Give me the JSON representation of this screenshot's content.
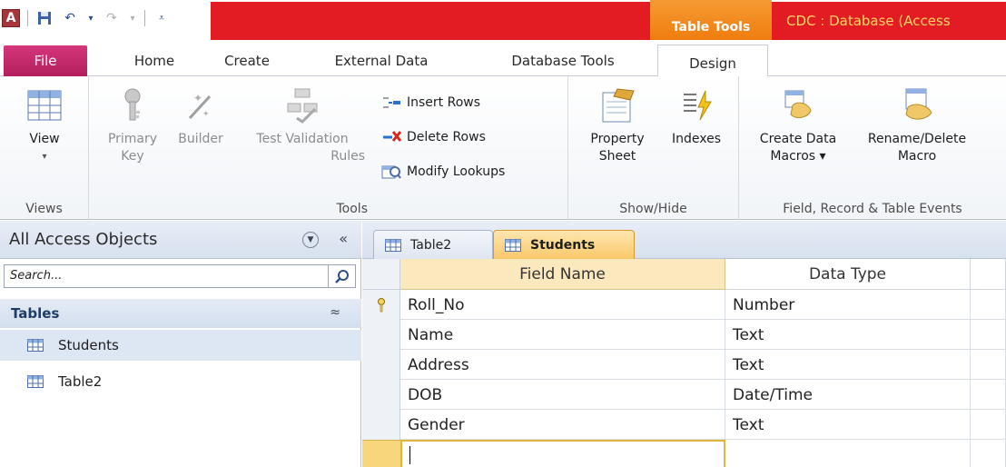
{
  "qat": {
    "app_letter": "A"
  },
  "title": {
    "context_tab": "Table Tools",
    "window_title": "CDC : Database (Access"
  },
  "tabs": {
    "file": "File",
    "home": "Home",
    "create": "Create",
    "external": "External Data",
    "dbtools": "Database Tools",
    "design": "Design"
  },
  "ribbon": {
    "views": {
      "label": "Views",
      "view_line1": "View",
      "view_line2": "▾"
    },
    "tools": {
      "label": "Tools",
      "primary_key_1": "Primary",
      "primary_key_2": "Key",
      "builder": "Builder",
      "test_validation_1": "Test Validation",
      "test_validation_2": "Rules",
      "insert_rows": "Insert Rows",
      "delete_rows": "Delete Rows",
      "modify_lookups": "Modify Lookups"
    },
    "showhide": {
      "label": "Show/Hide",
      "property_1": "Property",
      "property_2": "Sheet",
      "indexes": "Indexes"
    },
    "events": {
      "label": "Field, Record & Table Events",
      "create_macros_1": "Create Data",
      "create_macros_2": "Macros ▾",
      "rename_macro_1": "Rename/Delete",
      "rename_macro_2": "Macro"
    }
  },
  "nav": {
    "title": "All Access Objects",
    "search_placeholder": "Search...",
    "group": "Tables",
    "items": [
      {
        "label": "Students"
      },
      {
        "label": "Table2"
      }
    ]
  },
  "doc": {
    "tabs": [
      {
        "label": "Table2"
      },
      {
        "label": "Students"
      }
    ],
    "columns": {
      "field_name": "Field Name",
      "data_type": "Data Type"
    },
    "rows": [
      {
        "field": "Roll_No",
        "type": "Number",
        "key": true
      },
      {
        "field": "Name",
        "type": "Text"
      },
      {
        "field": "Address",
        "type": "Text"
      },
      {
        "field": "DOB",
        "type": "Date/Time"
      },
      {
        "field": "Gender",
        "type": "Text"
      }
    ]
  },
  "colors": {
    "title_red": "#e31b23",
    "table_tools_orange": "#f07d0e",
    "file_tab": "#b21f5c",
    "grid_header": "#fbe9bd",
    "selection_yellow": "#f8d77c"
  }
}
